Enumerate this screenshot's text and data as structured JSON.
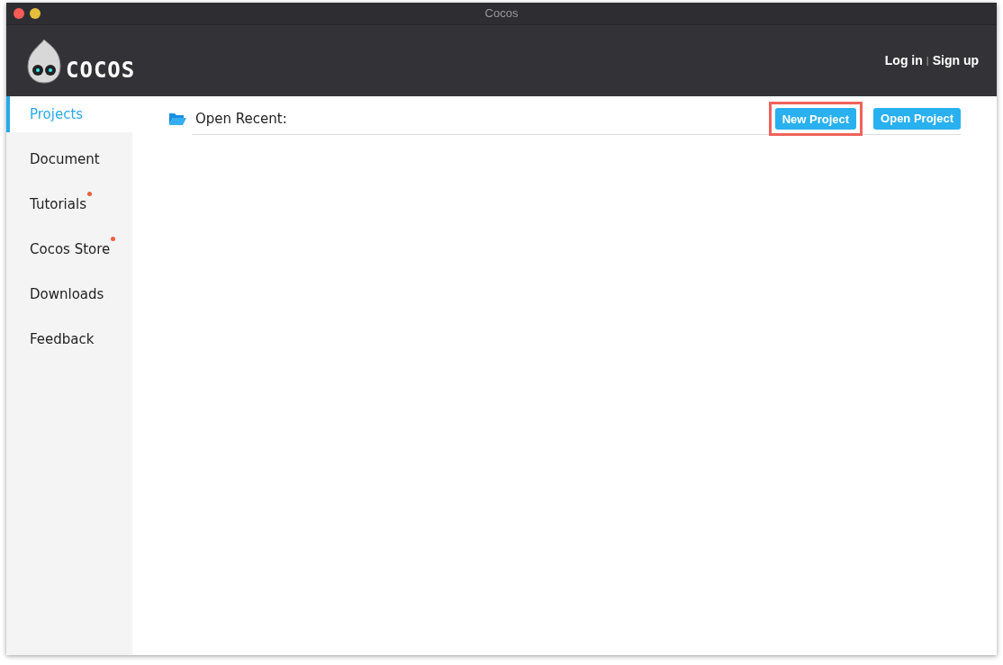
{
  "window": {
    "title": "Cocos"
  },
  "header": {
    "logo_text": "COCOS",
    "links": [
      {
        "label": "Log in"
      },
      {
        "label": "Sign up"
      }
    ],
    "separator": "|"
  },
  "sidebar": {
    "items": [
      {
        "label": "Projects",
        "selected": true,
        "badge": false
      },
      {
        "label": "Document",
        "selected": false,
        "badge": false
      },
      {
        "label": "Tutorials",
        "selected": false,
        "badge": true
      },
      {
        "label": "Cocos Store",
        "selected": false,
        "badge": true
      },
      {
        "label": "Downloads",
        "selected": false,
        "badge": false
      },
      {
        "label": "Feedback",
        "selected": false,
        "badge": false
      }
    ]
  },
  "main": {
    "recent_label": "Open Recent:",
    "buttons": [
      {
        "label": "New Project",
        "highlighted": true
      },
      {
        "label": "Open Project",
        "highlighted": false
      }
    ]
  }
}
